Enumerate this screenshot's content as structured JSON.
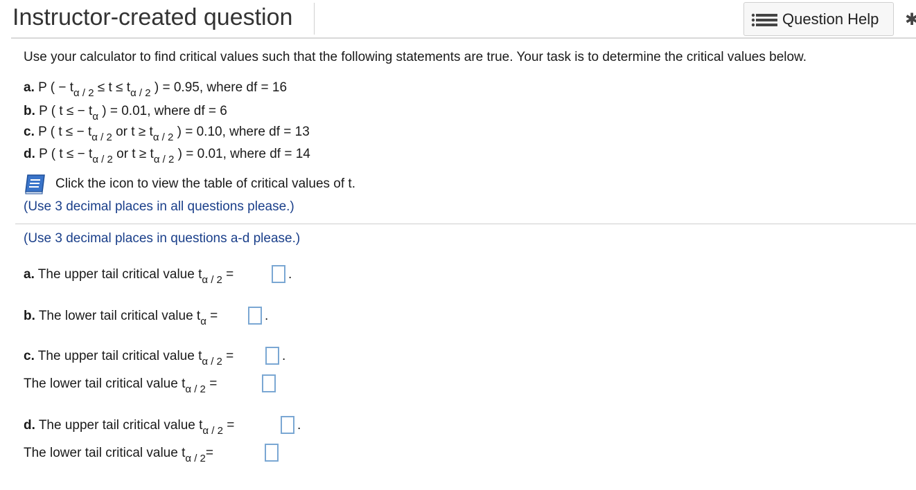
{
  "header": {
    "title": "Instructor-created question",
    "help_button_label": "Question Help",
    "help_icon": "list-icon",
    "settings_icon": "gear-icon"
  },
  "prompt": "Use your calculator  to find critical values such that the following statements are true. Your task is to determine the critical values below.",
  "statements": [
    {
      "letter": "a.",
      "text": "P ( − t",
      "sub1": "α / 2",
      "mid": " ≤ t ≤ t",
      "sub2": "α / 2",
      "end": " ) = 0.95, where df = 16"
    },
    {
      "letter": "b.",
      "text": "P ( t ≤ − t",
      "sub1": "α",
      "mid": " ) = 0.01, where df = 6"
    },
    {
      "letter": "c.",
      "text": "P ( t ≤ − t",
      "sub1": "α / 2",
      "mid": "  or t ≥ t",
      "sub2": "α / 2",
      "end": " ) = 0.10, where df = 13"
    },
    {
      "letter": "d.",
      "text": "P ( t ≤ − t",
      "sub1": "α / 2",
      "mid": " or t ≥ t",
      "sub2": "α / 2",
      "end": " ) = 0.01, where df = 14"
    }
  ],
  "table_link": {
    "icon": "book-icon",
    "label": "Click the icon to view the table of critical values of t."
  },
  "note_all": "(Use 3 decimal places in  all questions  please.)",
  "note_ad": "(Use 3 decimal places in  questions a-d  please.)",
  "questions": {
    "a_letter": "a.",
    "a_text": "The upper tail critical value  t",
    "a_sub": "α / 2",
    "b_letter": "b.",
    "b_text": "The lower tail critical value  t",
    "b_sub": "α",
    "c_letter": "c.",
    "c_upper_text": "The upper tail critical value  t",
    "c_upper_sub": "α / 2",
    "c_lower_text": "The lower tail critical value  t",
    "c_lower_sub": "α / 2",
    "d_letter": "d.",
    "d_upper_text": "The upper tail critical value  t",
    "d_upper_sub": "α / 2",
    "d_lower_text": "The lower tail critical value  t",
    "d_lower_sub": "α / 2",
    "equals": "=",
    "period": "."
  }
}
